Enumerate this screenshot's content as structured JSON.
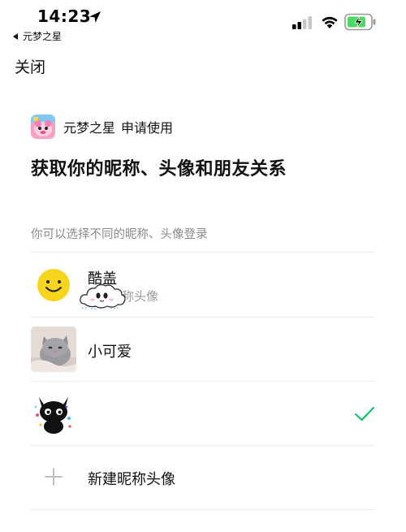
{
  "status_bar": {
    "time": "14:23",
    "back_app": "元梦之星",
    "accent_battery": "#4cd964"
  },
  "nav": {
    "close_label": "关闭"
  },
  "app": {
    "name": "元梦之星",
    "action": "申请使用"
  },
  "title": "获取你的昵称、头像和朋友关系",
  "hint": "你可以选择不同的昵称、头像登录",
  "accounts": [
    {
      "name": "酷盖",
      "sub": "称头像",
      "avatar_icon": "smiley-avatar-icon",
      "selected": false
    },
    {
      "name": "小可爱",
      "sub": "",
      "avatar_icon": "cat-photo-avatar-icon",
      "selected": false
    },
    {
      "name": "",
      "sub": "",
      "avatar_icon": "black-cat-avatar-icon",
      "selected": true
    }
  ],
  "new_profile": {
    "label": "新建昵称头像"
  },
  "colors": {
    "check": "#07c160",
    "muted": "#8a8a8a"
  }
}
